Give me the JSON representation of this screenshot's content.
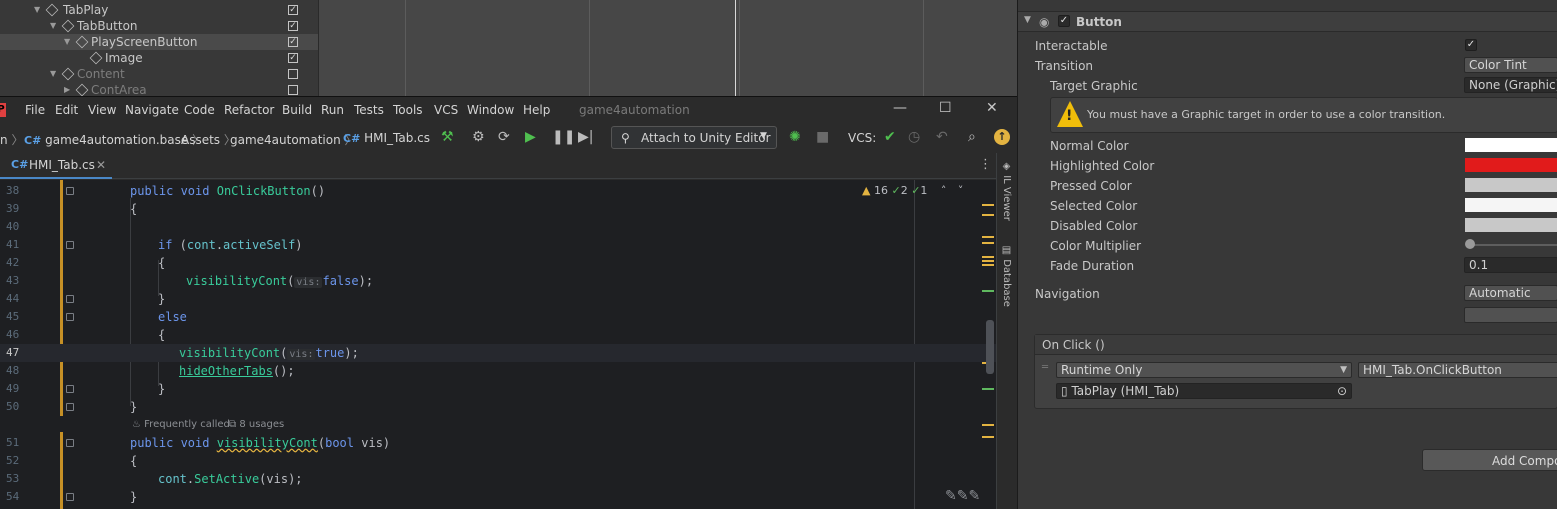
{
  "hierarchy": {
    "items": [
      {
        "label": "TabPlay",
        "checked": true
      },
      {
        "label": "TabButton",
        "checked": true
      },
      {
        "label": "PlayScreenButton",
        "checked": true
      },
      {
        "label": "Image",
        "checked": true
      },
      {
        "label": "Content",
        "checked": false
      },
      {
        "label": "ContArea",
        "checked": false
      }
    ]
  },
  "rider": {
    "menu": [
      "File",
      "Edit",
      "View",
      "Navigate",
      "Code",
      "Refactor",
      "Build",
      "Run",
      "Tests",
      "Tools",
      "VCS",
      "Window",
      "Help"
    ],
    "window_title": "game4automation",
    "breadcrumb": {
      "partial": "n",
      "project_prefix": "C#",
      "project": "game4automation.base",
      "folder1": "Assets",
      "folder2": "game4automation",
      "file_prefix": "C#",
      "file": "HMI_Tab.cs"
    },
    "run_config": "Attach to Unity Editor",
    "vcs_label": "VCS:",
    "tab": {
      "prefix": "C#",
      "name": "HMI_Tab.cs"
    },
    "inspections": {
      "warnings": "16",
      "weak": "2",
      "suggestions": "1"
    },
    "side_tools": [
      "IL Viewer",
      "Database"
    ],
    "code_lines": [
      {
        "n": "38"
      },
      {
        "n": "39"
      },
      {
        "n": "40"
      },
      {
        "n": "41"
      },
      {
        "n": "42"
      },
      {
        "n": "43"
      },
      {
        "n": "44"
      },
      {
        "n": "45"
      },
      {
        "n": "46"
      },
      {
        "n": "47"
      },
      {
        "n": "48"
      },
      {
        "n": "49"
      },
      {
        "n": "50"
      },
      {
        "n": "51"
      },
      {
        "n": "52"
      },
      {
        "n": "53"
      },
      {
        "n": "54"
      }
    ],
    "code_vision": {
      "freq": "Frequently called",
      "usages": "8 usages"
    },
    "param_hint": "vis:"
  },
  "inspector": {
    "component": "Button",
    "interactable_label": "Interactable",
    "interactable": true,
    "transition_label": "Transition",
    "transition": "Color Tint",
    "target_graphic_label": "Target Graphic",
    "target_graphic": "None (Graphic)",
    "warning": "You must have a Graphic target in order to use a color transition.",
    "colors": [
      {
        "label": "Normal Color",
        "color": "#ffffff"
      },
      {
        "label": "Highlighted Color",
        "color": "#e11b1b"
      },
      {
        "label": "Pressed Color",
        "color": "#c8c8c8"
      },
      {
        "label": "Selected Color",
        "color": "#f5f5f5"
      },
      {
        "label": "Disabled Color",
        "color": "#c8c8c8"
      }
    ],
    "color_multiplier_label": "Color Multiplier",
    "color_multiplier": 1,
    "fade_duration_label": "Fade Duration",
    "fade_duration": "0.1",
    "navigation_label": "Navigation",
    "navigation": "Automatic",
    "onclick_header": "On Click ()",
    "runtime": "Runtime Only",
    "function": "HMI_Tab.OnClickButton",
    "target_object": "TabPlay (HMI_Tab)",
    "add_component": "Add Compo"
  }
}
